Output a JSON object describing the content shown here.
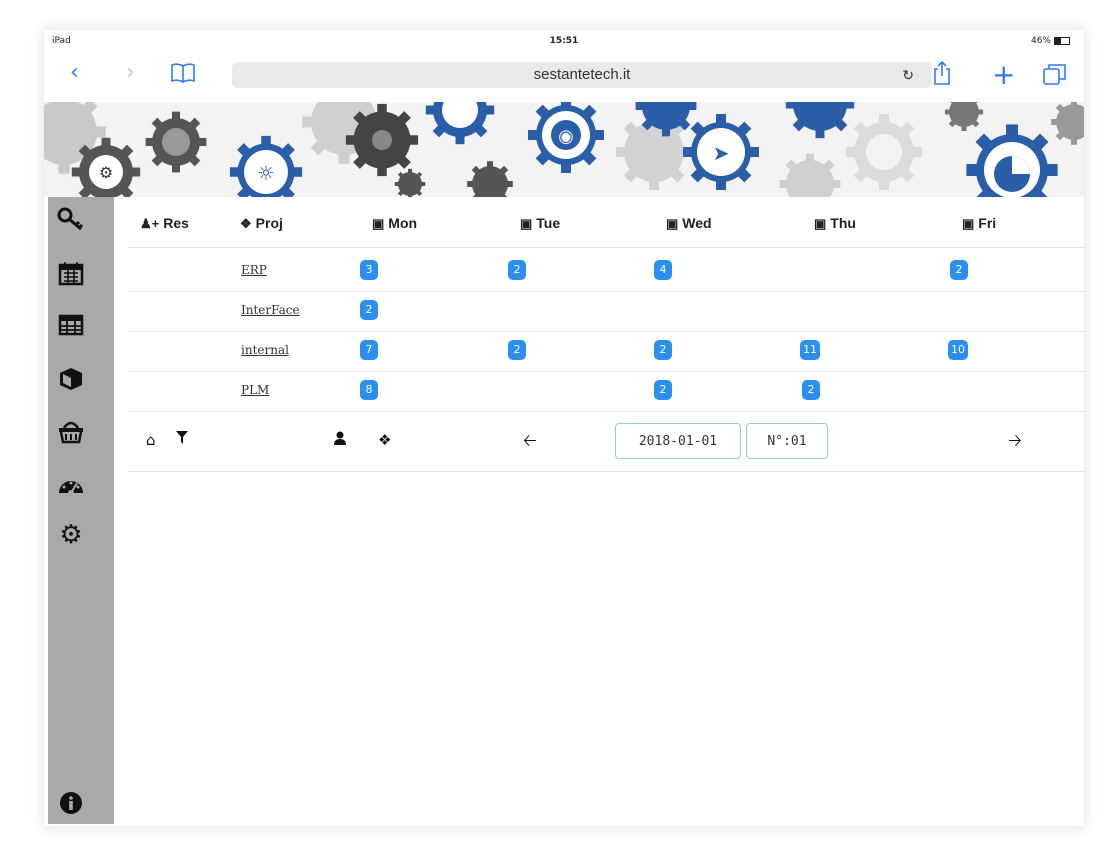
{
  "status_bar": {
    "device": "iPad",
    "time": "15:51",
    "battery": "46%"
  },
  "browser": {
    "url": "sestantetech.it"
  },
  "sidebar": {
    "items": [
      {
        "icon": "key-icon"
      },
      {
        "icon": "calendar-icon"
      },
      {
        "icon": "table-icon"
      },
      {
        "icon": "cube-icon"
      },
      {
        "icon": "basket-icon"
      },
      {
        "icon": "dashboard-icon"
      },
      {
        "icon": "gear-icon"
      },
      {
        "icon": "info-icon"
      }
    ]
  },
  "table": {
    "headers": {
      "res": "Res",
      "proj": "Proj",
      "mon": "Mon",
      "tue": "Tue",
      "wed": "Wed",
      "thu": "Thu",
      "fri": "Fri"
    },
    "rows": [
      {
        "project": "ERP",
        "mon": "3",
        "tue": "2",
        "wed": "4",
        "thu": "",
        "fri": "2"
      },
      {
        "project": "InterFace",
        "mon": "2",
        "tue": "",
        "wed": "",
        "thu": "",
        "fri": ""
      },
      {
        "project": "internal",
        "mon": "7",
        "tue": "2",
        "wed": "2",
        "thu": "11",
        "fri": "10"
      },
      {
        "project": "PLM",
        "mon": "8",
        "tue": "",
        "wed": "2",
        "thu": "2",
        "fri": ""
      }
    ]
  },
  "footer": {
    "date": "2018-01-01",
    "week": "N°:01"
  },
  "colors": {
    "badge": "#2b8ff0",
    "sidebar": "#a9a9a9",
    "ios_blue": "#2f7cf6",
    "gear_blue": "#2a5ea8"
  }
}
